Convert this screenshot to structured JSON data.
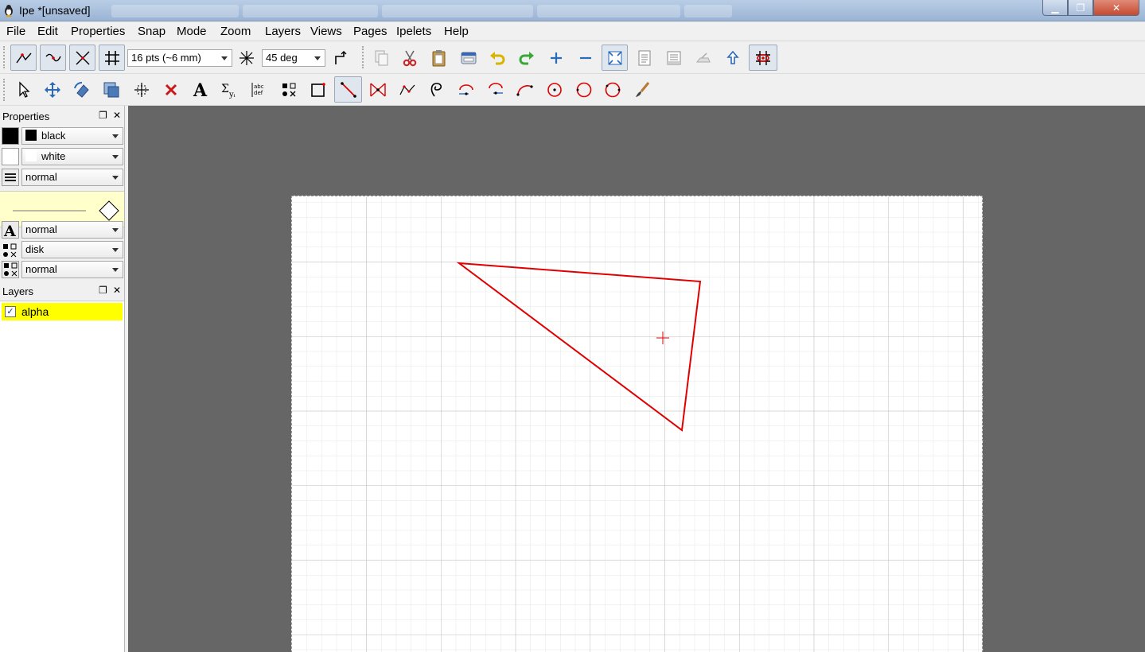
{
  "window": {
    "title": "Ipe *[unsaved]",
    "minimize_glyph": "▁",
    "maximize_glyph": "❐",
    "close_glyph": "✕"
  },
  "menu": [
    "File",
    "Edit",
    "Properties",
    "Snap",
    "Mode",
    "Zoom",
    "Layers",
    "Views",
    "Pages",
    "Ipelets",
    "Help"
  ],
  "toolbar1": {
    "snap_buttons": [
      "snap-vertex-icon",
      "snap-boundary-icon",
      "snap-intersection-icon",
      "snap-grid-icon"
    ],
    "grid_size": "16 pts (~6 mm)",
    "angle": "45 deg",
    "edit_buttons": [
      "copy-icon",
      "cut-icon",
      "paste-icon",
      "screenshot-icon",
      "undo-icon",
      "redo-icon",
      "zoom-in-icon",
      "zoom-out-icon",
      "fit-page-icon",
      "fit-objects-icon",
      "fit-selection-icon",
      "pan-icon",
      "zoom-to-top-icon",
      "grid-visible-icon"
    ]
  },
  "toolbar2": {
    "modes": [
      "select-icon",
      "translate-icon",
      "rotate-icon",
      "stretch-icon",
      "pan-icon",
      "shred-icon",
      "text-label-icon",
      "math-formula-icon",
      "paragraph-icon",
      "marks-icon",
      "rectangle-icon",
      "lines-icon",
      "polygon-icon",
      "splines-icon",
      "splinegon-icon",
      "arc-clockwise-icon",
      "arc-counterclockwise-icon",
      "arc-three-points-icon",
      "circle-center-icon",
      "circle-diameter-icon",
      "circle-three-points-icon",
      "ink-icon"
    ],
    "active_mode": "lines-icon"
  },
  "properties_panel": {
    "title": "Properties",
    "stroke": "black",
    "fill": "white",
    "pen": "normal",
    "text_size": "normal",
    "mark_shape": "disk",
    "symbol_size": "normal"
  },
  "layers_panel": {
    "title": "Layers",
    "layers": [
      {
        "name": "alpha",
        "visible": true,
        "checkmark": "✓"
      }
    ]
  },
  "colors": {
    "stroke_color": "#000000",
    "fill_color": "#ffffff",
    "drawing_color": "#e00000",
    "canvas_bg": "#666666",
    "active_layer": "#ffff00"
  }
}
